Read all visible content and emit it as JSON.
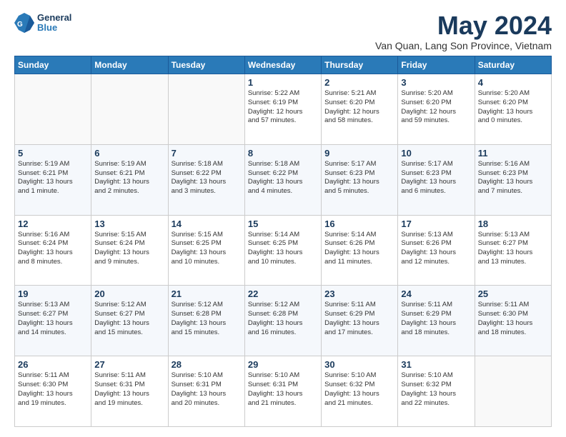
{
  "header": {
    "logo_line1": "General",
    "logo_line2": "Blue",
    "month_year": "May 2024",
    "location": "Van Quan, Lang Son Province, Vietnam"
  },
  "weekdays": [
    "Sunday",
    "Monday",
    "Tuesday",
    "Wednesday",
    "Thursday",
    "Friday",
    "Saturday"
  ],
  "weeks": [
    [
      {
        "day": "",
        "info": ""
      },
      {
        "day": "",
        "info": ""
      },
      {
        "day": "",
        "info": ""
      },
      {
        "day": "1",
        "info": "Sunrise: 5:22 AM\nSunset: 6:19 PM\nDaylight: 12 hours\nand 57 minutes."
      },
      {
        "day": "2",
        "info": "Sunrise: 5:21 AM\nSunset: 6:20 PM\nDaylight: 12 hours\nand 58 minutes."
      },
      {
        "day": "3",
        "info": "Sunrise: 5:20 AM\nSunset: 6:20 PM\nDaylight: 12 hours\nand 59 minutes."
      },
      {
        "day": "4",
        "info": "Sunrise: 5:20 AM\nSunset: 6:20 PM\nDaylight: 13 hours\nand 0 minutes."
      }
    ],
    [
      {
        "day": "5",
        "info": "Sunrise: 5:19 AM\nSunset: 6:21 PM\nDaylight: 13 hours\nand 1 minute."
      },
      {
        "day": "6",
        "info": "Sunrise: 5:19 AM\nSunset: 6:21 PM\nDaylight: 13 hours\nand 2 minutes."
      },
      {
        "day": "7",
        "info": "Sunrise: 5:18 AM\nSunset: 6:22 PM\nDaylight: 13 hours\nand 3 minutes."
      },
      {
        "day": "8",
        "info": "Sunrise: 5:18 AM\nSunset: 6:22 PM\nDaylight: 13 hours\nand 4 minutes."
      },
      {
        "day": "9",
        "info": "Sunrise: 5:17 AM\nSunset: 6:23 PM\nDaylight: 13 hours\nand 5 minutes."
      },
      {
        "day": "10",
        "info": "Sunrise: 5:17 AM\nSunset: 6:23 PM\nDaylight: 13 hours\nand 6 minutes."
      },
      {
        "day": "11",
        "info": "Sunrise: 5:16 AM\nSunset: 6:23 PM\nDaylight: 13 hours\nand 7 minutes."
      }
    ],
    [
      {
        "day": "12",
        "info": "Sunrise: 5:16 AM\nSunset: 6:24 PM\nDaylight: 13 hours\nand 8 minutes."
      },
      {
        "day": "13",
        "info": "Sunrise: 5:15 AM\nSunset: 6:24 PM\nDaylight: 13 hours\nand 9 minutes."
      },
      {
        "day": "14",
        "info": "Sunrise: 5:15 AM\nSunset: 6:25 PM\nDaylight: 13 hours\nand 10 minutes."
      },
      {
        "day": "15",
        "info": "Sunrise: 5:14 AM\nSunset: 6:25 PM\nDaylight: 13 hours\nand 10 minutes."
      },
      {
        "day": "16",
        "info": "Sunrise: 5:14 AM\nSunset: 6:26 PM\nDaylight: 13 hours\nand 11 minutes."
      },
      {
        "day": "17",
        "info": "Sunrise: 5:13 AM\nSunset: 6:26 PM\nDaylight: 13 hours\nand 12 minutes."
      },
      {
        "day": "18",
        "info": "Sunrise: 5:13 AM\nSunset: 6:27 PM\nDaylight: 13 hours\nand 13 minutes."
      }
    ],
    [
      {
        "day": "19",
        "info": "Sunrise: 5:13 AM\nSunset: 6:27 PM\nDaylight: 13 hours\nand 14 minutes."
      },
      {
        "day": "20",
        "info": "Sunrise: 5:12 AM\nSunset: 6:27 PM\nDaylight: 13 hours\nand 15 minutes."
      },
      {
        "day": "21",
        "info": "Sunrise: 5:12 AM\nSunset: 6:28 PM\nDaylight: 13 hours\nand 15 minutes."
      },
      {
        "day": "22",
        "info": "Sunrise: 5:12 AM\nSunset: 6:28 PM\nDaylight: 13 hours\nand 16 minutes."
      },
      {
        "day": "23",
        "info": "Sunrise: 5:11 AM\nSunset: 6:29 PM\nDaylight: 13 hours\nand 17 minutes."
      },
      {
        "day": "24",
        "info": "Sunrise: 5:11 AM\nSunset: 6:29 PM\nDaylight: 13 hours\nand 18 minutes."
      },
      {
        "day": "25",
        "info": "Sunrise: 5:11 AM\nSunset: 6:30 PM\nDaylight: 13 hours\nand 18 minutes."
      }
    ],
    [
      {
        "day": "26",
        "info": "Sunrise: 5:11 AM\nSunset: 6:30 PM\nDaylight: 13 hours\nand 19 minutes."
      },
      {
        "day": "27",
        "info": "Sunrise: 5:11 AM\nSunset: 6:31 PM\nDaylight: 13 hours\nand 19 minutes."
      },
      {
        "day": "28",
        "info": "Sunrise: 5:10 AM\nSunset: 6:31 PM\nDaylight: 13 hours\nand 20 minutes."
      },
      {
        "day": "29",
        "info": "Sunrise: 5:10 AM\nSunset: 6:31 PM\nDaylight: 13 hours\nand 21 minutes."
      },
      {
        "day": "30",
        "info": "Sunrise: 5:10 AM\nSunset: 6:32 PM\nDaylight: 13 hours\nand 21 minutes."
      },
      {
        "day": "31",
        "info": "Sunrise: 5:10 AM\nSunset: 6:32 PM\nDaylight: 13 hours\nand 22 minutes."
      },
      {
        "day": "",
        "info": ""
      }
    ]
  ]
}
